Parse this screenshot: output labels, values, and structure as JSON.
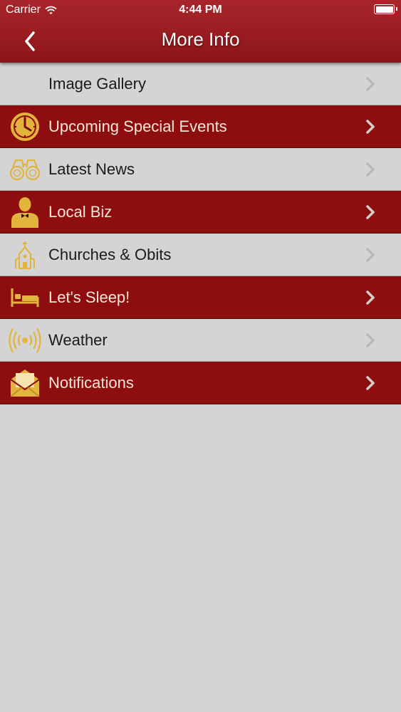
{
  "status_bar": {
    "carrier": "Carrier",
    "time": "4:44 PM"
  },
  "nav": {
    "title": "More Info",
    "back_icon": "chevron-left-icon"
  },
  "colors": {
    "header": "#9c1c20",
    "dark_row": "#8e0e0f",
    "light_row": "#d4d4d4",
    "gold": "#e2b43c"
  },
  "menu": {
    "items": [
      {
        "label": "Image Gallery",
        "icon": "none",
        "style": "light"
      },
      {
        "label": "Upcoming Special Events",
        "icon": "clock-icon",
        "style": "dark"
      },
      {
        "label": "Latest News",
        "icon": "binoculars-icon",
        "style": "light"
      },
      {
        "label": "Local Biz",
        "icon": "businessman-icon",
        "style": "dark"
      },
      {
        "label": "Churches & Obits",
        "icon": "church-icon",
        "style": "light"
      },
      {
        "label": "Let's Sleep!",
        "icon": "bed-icon",
        "style": "dark"
      },
      {
        "label": "Weather",
        "icon": "broadcast-icon",
        "style": "light"
      },
      {
        "label": "Notifications",
        "icon": "envelope-icon",
        "style": "dark"
      }
    ]
  }
}
